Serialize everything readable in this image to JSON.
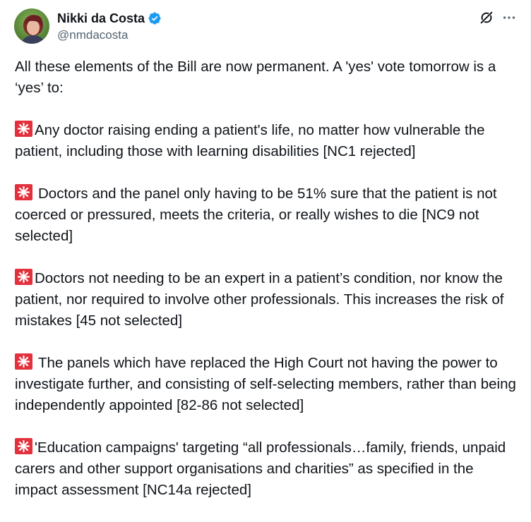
{
  "author": {
    "display_name": "Nikki da Costa",
    "handle": "@nmdacosta",
    "verified": true,
    "verified_color": "#1d9bf0"
  },
  "icons": {
    "verified": "verified-badge-icon",
    "grok": "grok-icon",
    "more": "more-options-icon",
    "bullet": "police-car-light-emoji"
  },
  "tweet": {
    "intro": "All these elements of the Bill are now permanent. A 'yes' vote tomorrow is a ‘yes’ to:",
    "points": [
      {
        "text": "Any doctor raising ending a patient's life, no matter how vulnerable the patient, including those with learning disabilities [NC1 rejected]"
      },
      {
        "text": "Doctors and the panel only having to be 51% sure that the patient is not coerced or pressured, meets the criteria, or really wishes to die [NC9 not selected]"
      },
      {
        "text": "Doctors not needing to be an expert in a patient’s condition, nor know the patient, nor required to involve other professionals. This increases the risk of mistakes [45 not selected]"
      },
      {
        "text": "The panels which have replaced the High Court not having the power to investigate further, and consisting of self-selecting members, rather than being independently appointed [82-86 not selected]"
      },
      {
        "text": "'Education campaigns' targeting “all professionals…family, friends, unpaid carers and other support organisations and charities” as specified in the impact assessment [NC14a rejected]"
      }
    ]
  },
  "colors": {
    "text": "#0f1419",
    "secondary_text": "#536471",
    "siren_red": "#e2313d"
  }
}
